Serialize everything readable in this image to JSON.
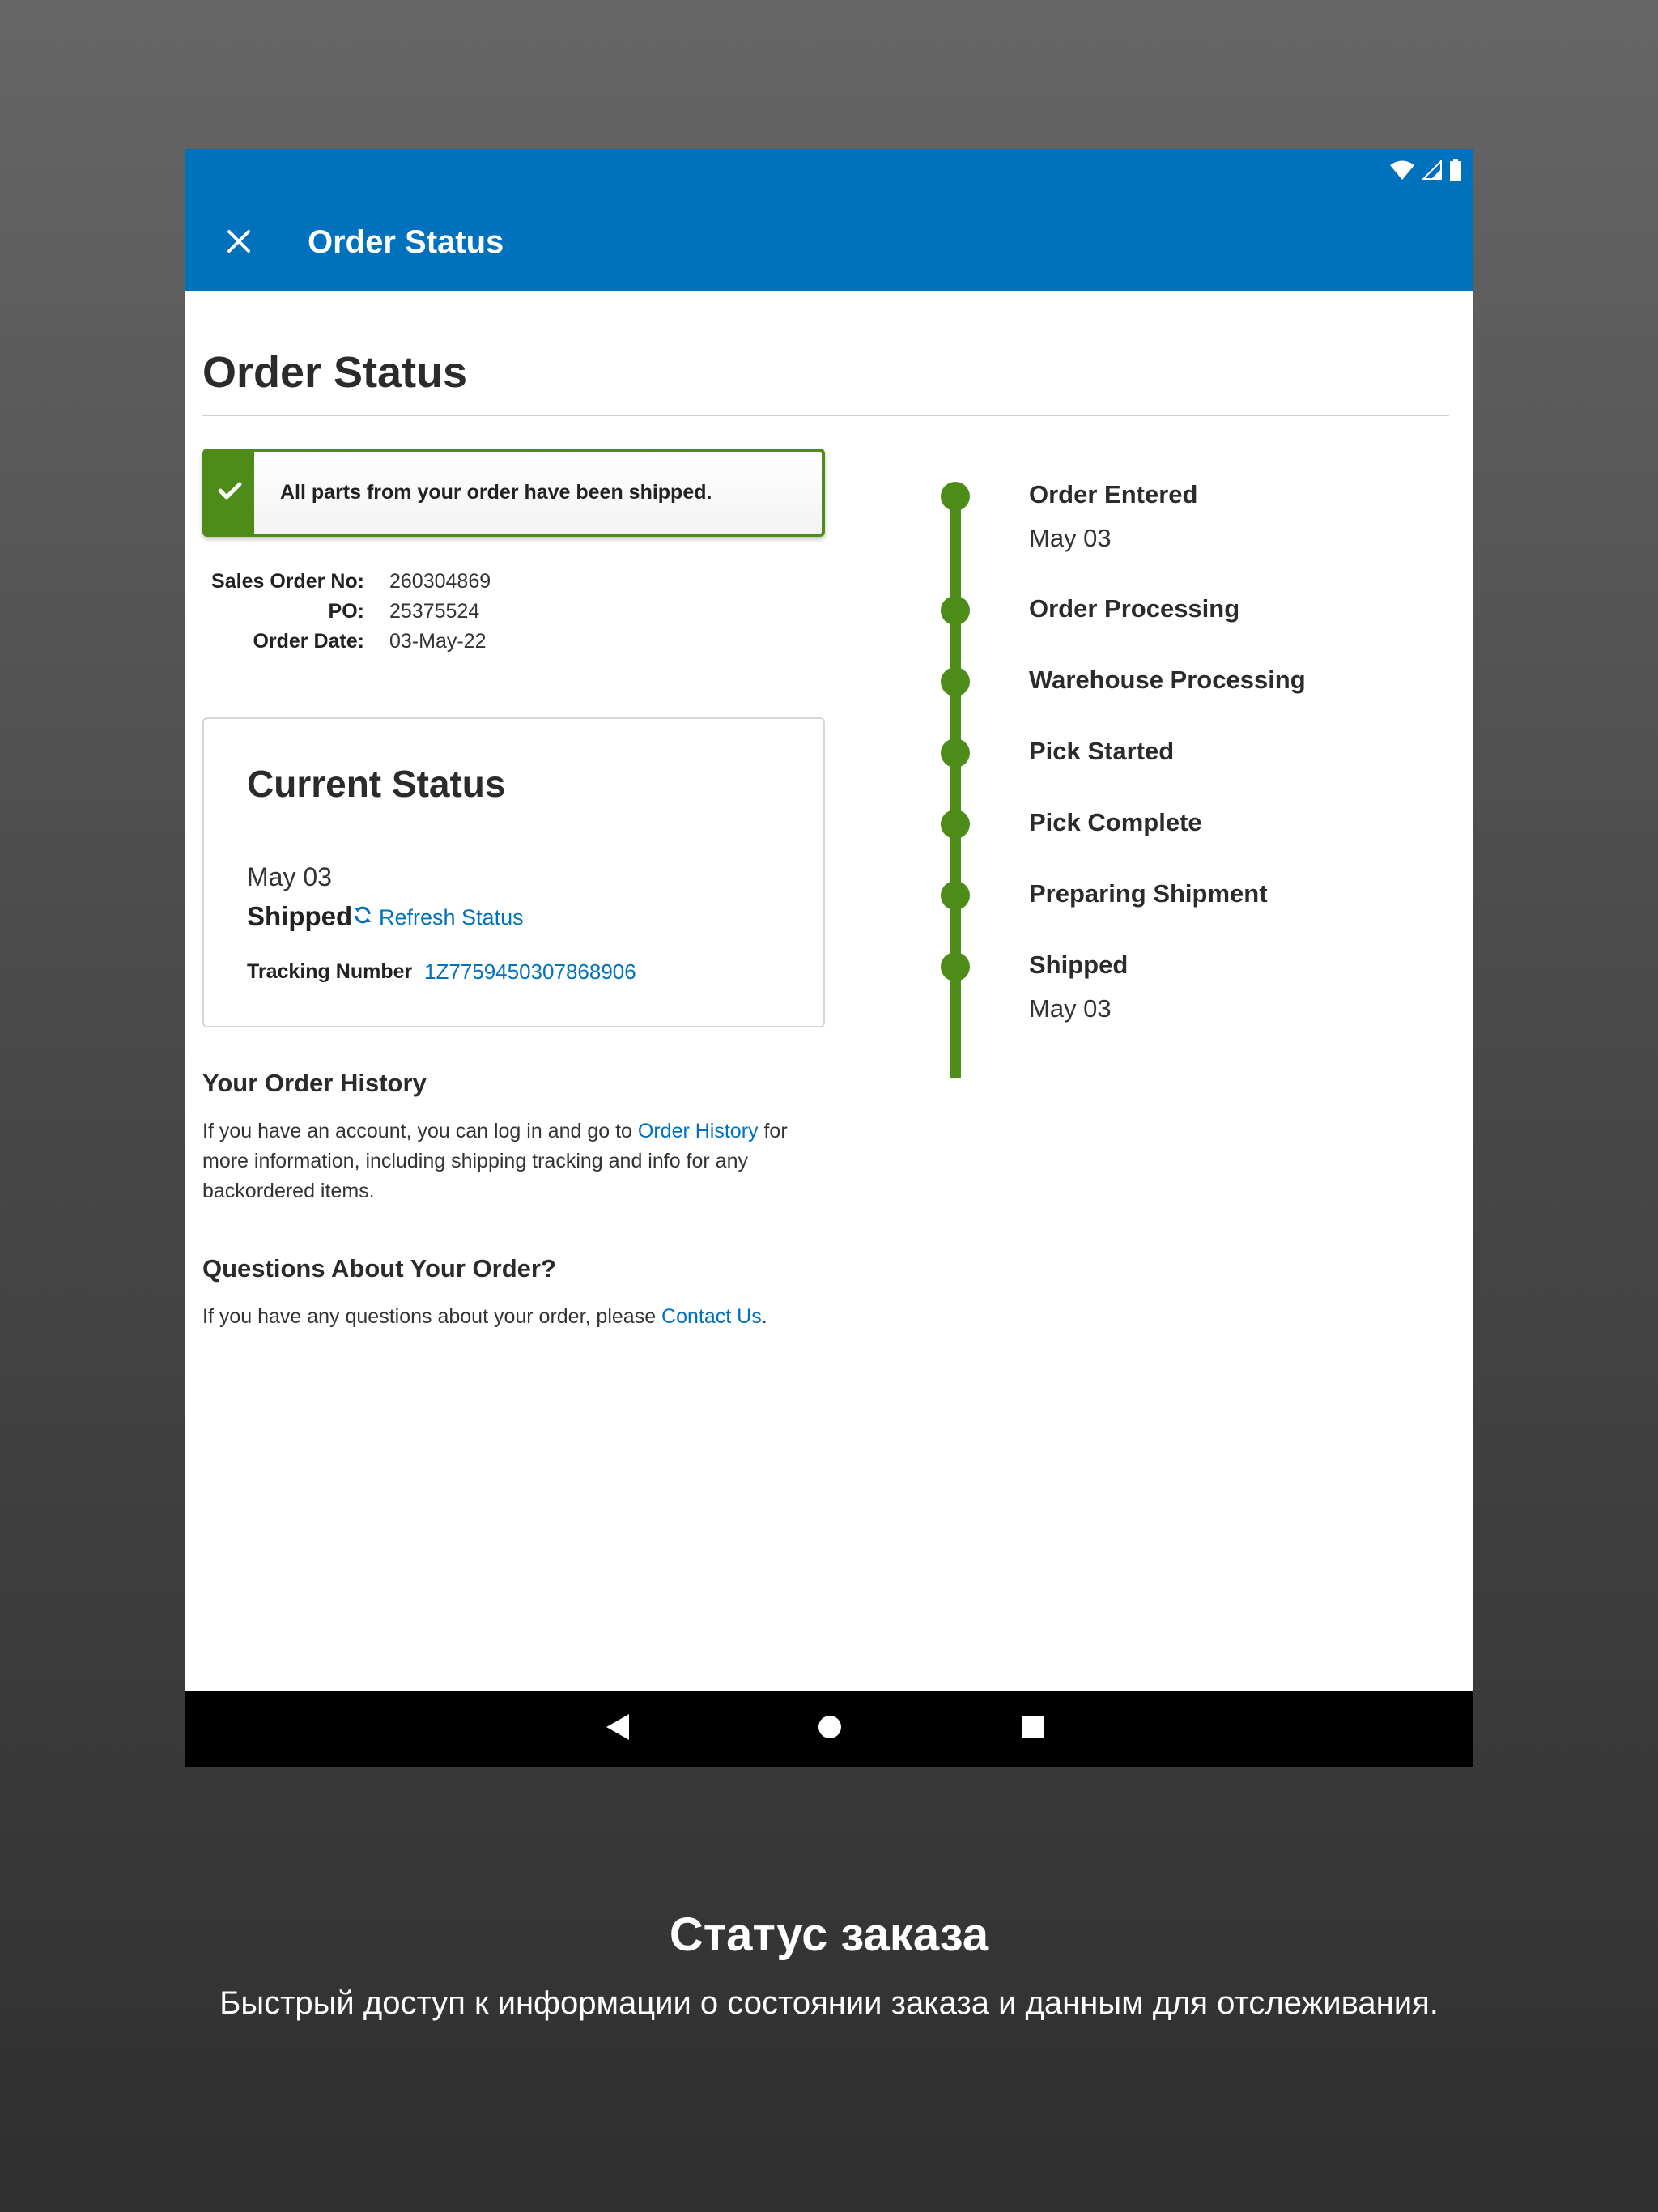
{
  "app_bar": {
    "title": "Order Status",
    "background": "#0071BD",
    "close_icon": "close-icon",
    "status_icons": [
      "wifi-icon",
      "signal-icon",
      "battery-icon"
    ]
  },
  "page": {
    "title": "Order Status"
  },
  "alert": {
    "message": "All parts from your order have been shipped.",
    "icon": "checkmark-icon",
    "accent": "#4E8C1A"
  },
  "order_info": [
    {
      "label": "Sales Order No:",
      "value": "260304869"
    },
    {
      "label": "PO:",
      "value": "25375524"
    },
    {
      "label": "Order Date:",
      "value": "03-May-22"
    }
  ],
  "current_status": {
    "title": "Current Status",
    "date": "May 03",
    "status": "Shipped",
    "refresh_label": "Refresh Status",
    "refresh_icon": "refresh-icon",
    "tracking_label": "Tracking Number",
    "tracking_number": "1Z7759450307868906"
  },
  "history": {
    "heading": "Your Order History",
    "text_before": "If you have an account, you can log in and go to ",
    "link": "Order History",
    "text_after": " for more information, including shipping tracking and info for any backordered items."
  },
  "questions": {
    "heading": "Questions About Your Order?",
    "text_before": "If you have any questions about your order, please ",
    "link": "Contact Us",
    "text_after": "."
  },
  "timeline": {
    "color": "#4E8C1A",
    "steps": [
      {
        "label": "Order Entered",
        "date": "May 03"
      },
      {
        "label": "Order Processing",
        "date": ""
      },
      {
        "label": "Warehouse Processing",
        "date": ""
      },
      {
        "label": "Pick Started",
        "date": ""
      },
      {
        "label": "Pick Complete",
        "date": ""
      },
      {
        "label": "Preparing Shipment",
        "date": ""
      },
      {
        "label": "Shipped",
        "date": "May 03"
      }
    ]
  },
  "nav_bar": {
    "buttons": [
      "back-icon",
      "home-icon",
      "recents-icon"
    ]
  },
  "caption": {
    "title": "Статус заказа",
    "subtitle": "Быстрый доступ к информации о состоянии заказа и данным для отслеживания."
  }
}
